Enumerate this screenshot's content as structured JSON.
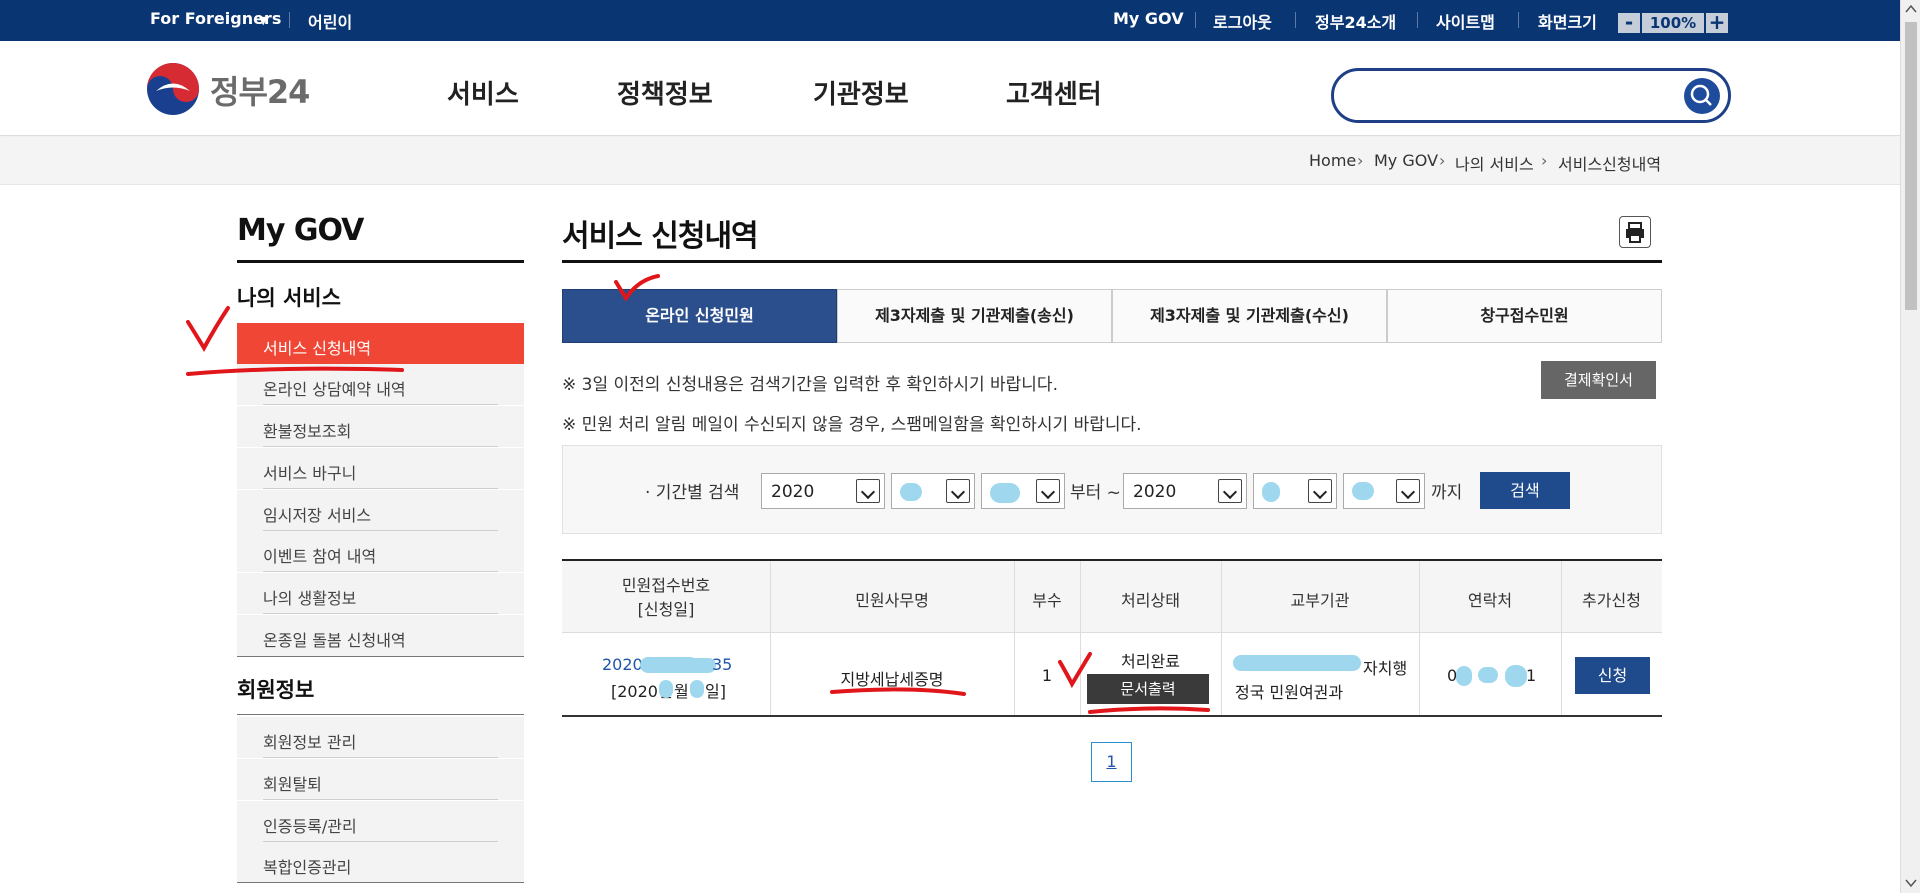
{
  "topbar": {
    "foreigners": "For Foreigners",
    "kids": "어린이",
    "mygov": "My GOV",
    "logout": "로그아웃",
    "intro": "정부24소개",
    "sitemap": "사이트맵",
    "zoom_label": "화면크기",
    "zoom_minus": "-",
    "zoom_value": "100%",
    "zoom_plus": "+"
  },
  "header": {
    "logo_text": "정부24",
    "nav": [
      "서비스",
      "정책정보",
      "기관정보",
      "고객센터"
    ],
    "search_placeholder": ""
  },
  "breadcrumb": [
    "Home",
    "My GOV",
    "나의 서비스",
    "서비스신청내역"
  ],
  "sidebar": {
    "title": "My GOV",
    "section1": "나의 서비스",
    "items1": [
      "서비스 신청내역",
      "온라인 상담예약 내역",
      "환불정보조회",
      "서비스 바구니",
      "임시저장 서비스",
      "이벤트 참여 내역",
      "나의 생활정보",
      "온종일 돌봄 신청내역"
    ],
    "section2": "회원정보",
    "items2": [
      "회원정보 관리",
      "회원탈퇴",
      "인증등록/관리",
      "복합인증관리"
    ]
  },
  "main": {
    "title": "서비스 신청내역",
    "tabs": [
      "온라인 신청민원",
      "제3자제출 및 기관제출(송신)",
      "제3자제출 및 기관제출(수신)",
      "창구접수민원"
    ],
    "notes": [
      "※ 3일 이전의 신청내용은 검색기간을 입력한 후 확인하시기 바랍니다.",
      "※ 민원 처리 알림 메일이 수신되지 않을 경우, 스팸메일함을 확인하시기 바랍니다."
    ],
    "receipt_button": "결제확인서",
    "filter": {
      "label": "· 기간별 검색",
      "from_year": "2020",
      "to_year": "2020",
      "from_text": "부터 ~",
      "to_text": "까지",
      "search_button": "검색"
    },
    "table": {
      "headers": [
        "민원접수번호\n[신청일]",
        "민원사무명",
        "부수",
        "처리상태",
        "교부기관",
        "연락처",
        "추가신청"
      ],
      "row": {
        "receipt_no_start": "2020",
        "receipt_no_end": "35",
        "date_start": "[2020년",
        "date_mid": "월",
        "date_end": "일]",
        "service": "지방세납세증명",
        "copies": "1",
        "status": "처리완료",
        "print_button": "문서출력",
        "agency_line1": "자치행",
        "agency_line2": "정국 민원여권과",
        "contact_start": "0",
        "contact_end": "1",
        "apply_button": "신청"
      }
    },
    "pagination": [
      "1"
    ]
  }
}
